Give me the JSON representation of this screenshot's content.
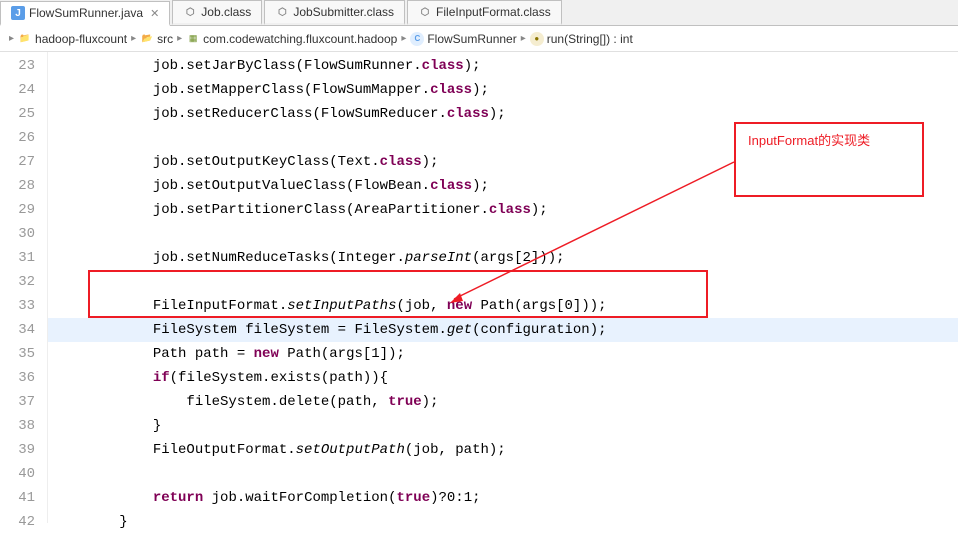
{
  "tabs": [
    {
      "label": "FlowSumRunner.java",
      "active": true,
      "icon": "java"
    },
    {
      "label": "Job.class",
      "active": false,
      "icon": "class"
    },
    {
      "label": "JobSubmitter.class",
      "active": false,
      "icon": "class"
    },
    {
      "label": "FileInputFormat.class",
      "active": false,
      "icon": "class"
    }
  ],
  "breadcrumb": {
    "project": "hadoop-fluxcount",
    "src": "src",
    "pkg": "com.codewatching.fluxcount.hadoop",
    "class": "FlowSumRunner",
    "method": "run(String[]) : int"
  },
  "lines": {
    "start": 23,
    "end": 42
  },
  "code": {
    "l23": "            job.setJarByClass(FlowSumRunner.",
    "l23b": "class",
    "l23c": ");",
    "l24": "            job.setMapperClass(FlowSumMapper.",
    "l24b": "class",
    "l24c": ");",
    "l25": "            job.setReducerClass(FlowSumReducer.",
    "l25b": "class",
    "l25c": ");",
    "l27": "            job.setOutputKeyClass(Text.",
    "l27b": "class",
    "l27c": ");",
    "l28": "            job.setOutputValueClass(FlowBean.",
    "l28b": "class",
    "l28c": ");",
    "l29": "            job.setPartitionerClass(AreaPartitioner.",
    "l29b": "class",
    "l29c": ");",
    "l31a": "            job.setNumReduceTasks(Integer.",
    "l31b": "parseInt",
    "l31c": "(args[2]));",
    "l33a": "            FileInputFormat.",
    "l33b": "setInputPaths",
    "l33c": "(job, ",
    "l33d": "new",
    "l33e": " Path(args[0]));",
    "l34a": "            FileSystem fileSystem = FileSystem.",
    "l34b": "get",
    "l34c": "(configuration);",
    "l35a": "            Path path = ",
    "l35b": "new",
    "l35c": " Path(args[1]);",
    "l36a": "            ",
    "l36b": "if",
    "l36c": "(fileSystem.exists(path)){",
    "l37a": "                fileSystem.delete(path, ",
    "l37b": "true",
    "l37c": ");",
    "l38": "            }",
    "l39a": "            FileOutputFormat.",
    "l39b": "setOutputPath",
    "l39c": "(job, path);",
    "l41a": "            ",
    "l41b": "return",
    "l41c": " job.waitForCompletion(",
    "l41d": "true",
    "l41e": ")?0:1;",
    "l42": "        }"
  },
  "annotation": {
    "label": "InputFormat的实现类"
  }
}
